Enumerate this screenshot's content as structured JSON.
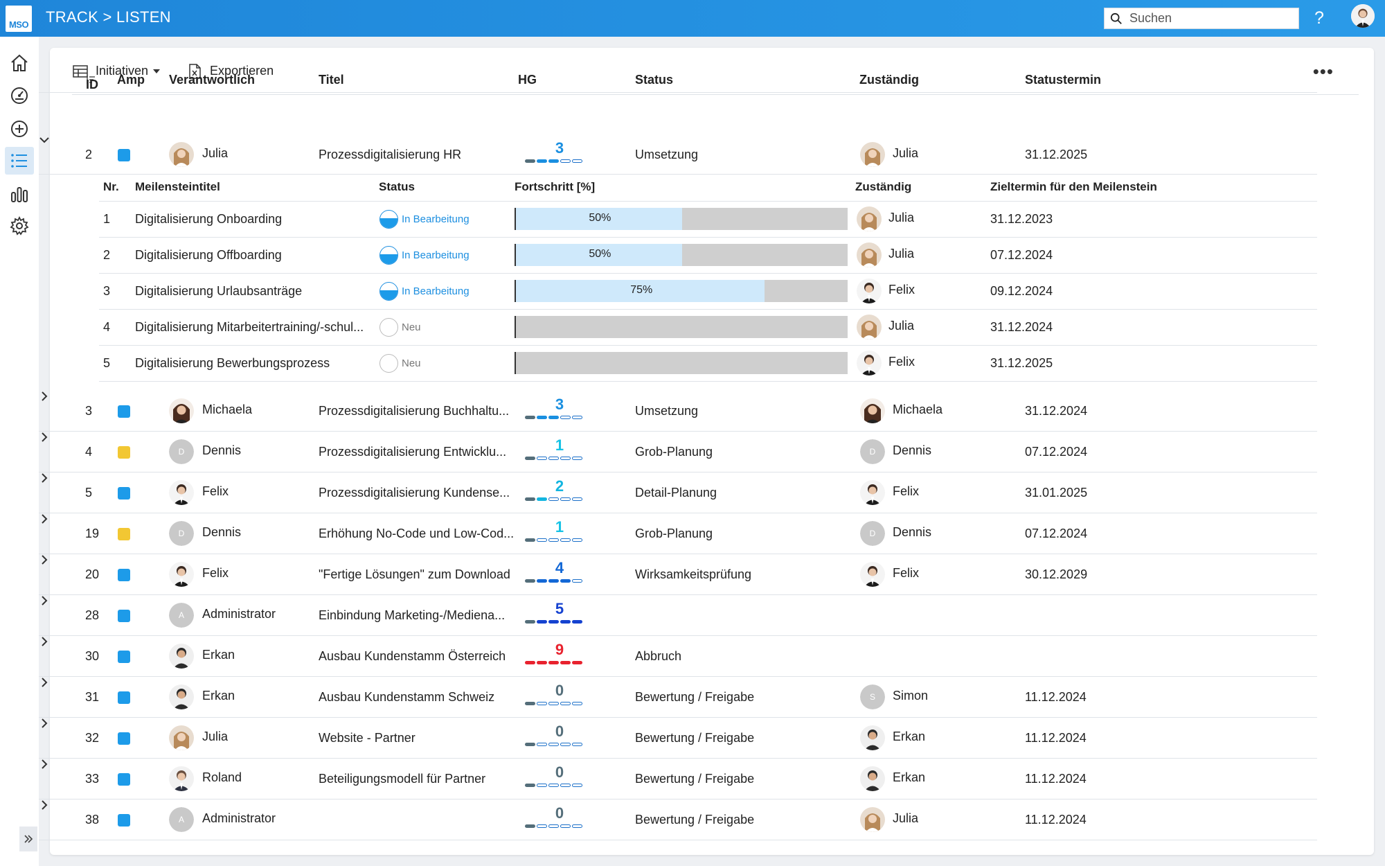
{
  "app": {
    "logo_text": "MSO",
    "breadcrumb": "TRACK > LISTEN",
    "help": "?"
  },
  "search": {
    "placeholder": "Suchen"
  },
  "toolbar": {
    "initiatives_label": "Initiativen",
    "export_label": "Exportieren",
    "more": "•••"
  },
  "table": {
    "headers": {
      "id": "ID",
      "amp": "Amp",
      "resp": "Verantwortlich",
      "title": "Titel",
      "hg": "HG",
      "status": "Status",
      "zust": "Zuständig",
      "date": "Statustermin"
    },
    "expanded_row": {
      "id": "2",
      "amp": "blue",
      "resp": "Julia",
      "title": "Prozessdigitalisierung HR",
      "hg": "3",
      "status": "Umsetzung",
      "zust": "Julia",
      "date": "31.12.2025"
    },
    "milestones": {
      "headers": {
        "nr": "Nr.",
        "title": "Meilensteintitel",
        "status": "Status",
        "progress": "Fortschritt [%]",
        "zust": "Zuständig",
        "date": "Zieltermin für den Meilenstein"
      },
      "rows": [
        {
          "nr": "1",
          "title": "Digitalisierung Onboarding",
          "status": "In Bearbeitung",
          "progress_label": "50%",
          "progress": 0.5,
          "zust": "Julia",
          "date": "31.12.2023"
        },
        {
          "nr": "2",
          "title": "Digitalisierung Offboarding",
          "status": "In Bearbeitung",
          "progress_label": "50%",
          "progress": 0.5,
          "zust": "Julia",
          "date": "07.12.2024"
        },
        {
          "nr": "3",
          "title": "Digitalisierung Urlaubsanträge",
          "status": "In Bearbeitung",
          "progress_label": "75%",
          "progress": 0.75,
          "zust": "Felix",
          "date": "09.12.2024"
        },
        {
          "nr": "4",
          "title": "Digitalisierung Mitarbeitertraining/-schul...",
          "status": "Neu",
          "progress_label": "",
          "progress": 0,
          "zust": "Julia",
          "date": "31.12.2024"
        },
        {
          "nr": "5",
          "title": "Digitalisierung Bewerbungsprozess",
          "status": "Neu",
          "progress_label": "",
          "progress": 0,
          "zust": "Felix",
          "date": "31.12.2025"
        }
      ]
    },
    "rows": [
      {
        "id": "3",
        "amp": "blue",
        "resp": "Michaela",
        "title": "Prozessdigitalisierung Buchhaltu...",
        "hg": "3",
        "status": "Umsetzung",
        "zust": "Michaela",
        "date": "31.12.2024"
      },
      {
        "id": "4",
        "amp": "yellow",
        "resp": "Dennis",
        "title": "Prozessdigitalisierung Entwicklu...",
        "hg": "1",
        "status": "Grob-Planung",
        "zust": "Dennis",
        "date": "07.12.2024"
      },
      {
        "id": "5",
        "amp": "blue",
        "resp": "Felix",
        "title": "Prozessdigitalisierung Kundense...",
        "hg": "2",
        "status": "Detail-Planung",
        "zust": "Felix",
        "date": "31.01.2025"
      },
      {
        "id": "19",
        "amp": "yellow",
        "resp": "Dennis",
        "title": "Erhöhung No-Code und Low-Cod...",
        "hg": "1",
        "status": "Grob-Planung",
        "zust": "Dennis",
        "date": "07.12.2024"
      },
      {
        "id": "20",
        "amp": "blue",
        "resp": "Felix",
        "title": "\"Fertige Lösungen\" zum Download",
        "hg": "4",
        "status": "Wirksamkeitsprüfung",
        "zust": "Felix",
        "date": "30.12.2029"
      },
      {
        "id": "28",
        "amp": "blue",
        "resp": "Administrator",
        "title": "Einbindung Marketing-/Mediena...",
        "hg": "5",
        "status": "",
        "zust": "",
        "date": ""
      },
      {
        "id": "30",
        "amp": "blue",
        "resp": "Erkan",
        "title": "Ausbau Kundenstamm Österreich",
        "hg": "9",
        "status": "Abbruch",
        "zust": "",
        "date": ""
      },
      {
        "id": "31",
        "amp": "blue",
        "resp": "Erkan",
        "title": "Ausbau Kundenstamm Schweiz",
        "hg": "0",
        "status": "Bewertung / Freigabe",
        "zust": "Simon",
        "date": "11.12.2024"
      },
      {
        "id": "32",
        "amp": "blue",
        "resp": "Julia",
        "title": "Website - Partner",
        "hg": "0",
        "status": "Bewertung / Freigabe",
        "zust": "Erkan",
        "date": "11.12.2024"
      },
      {
        "id": "33",
        "amp": "blue",
        "resp": "Roland",
        "title": "Beteiligungsmodell für Partner",
        "hg": "0",
        "status": "Bewertung / Freigabe",
        "zust": "Erkan",
        "date": "11.12.2024"
      },
      {
        "id": "38",
        "amp": "blue",
        "resp": "Administrator",
        "title": "",
        "hg": "0",
        "status": "Bewertung / Freigabe",
        "zust": "Julia",
        "date": "11.12.2024"
      }
    ]
  },
  "colors": {
    "topbar": "#1f86d9",
    "amp_blue": "#1d9be9",
    "amp_yellow": "#f2c733",
    "hg_0": "#546e7a",
    "hg_1": "#17c3e6",
    "hg_2": "#12b5e0",
    "hg_3": "#1a8fe0",
    "hg_4": "#1368d6",
    "hg_5": "#1542d0",
    "hg_9": "#e8222e"
  },
  "icons": {
    "home": "home-icon",
    "dashboard": "speedometer-icon",
    "add": "plus-circle-icon",
    "list": "list-icon",
    "chart": "bar-chart-icon",
    "settings": "gear-icon"
  }
}
